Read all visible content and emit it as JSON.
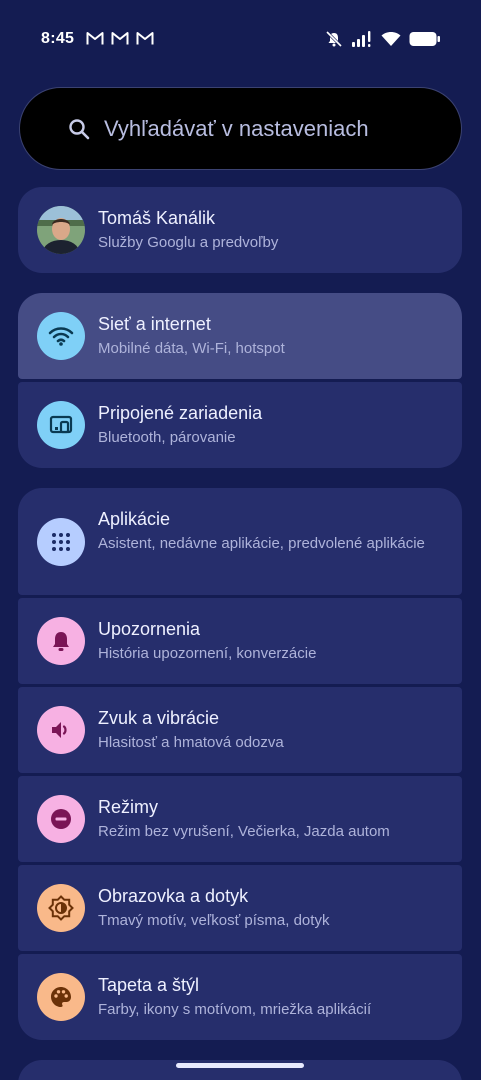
{
  "status_bar": {
    "time": "8:45",
    "notification_icons": [
      "gmail-icon",
      "gmail-icon",
      "gmail-icon"
    ],
    "right_icons": [
      "mute-icon",
      "signal-icon",
      "wifi-icon",
      "battery-icon"
    ]
  },
  "search": {
    "placeholder": "Vyhľadávať v nastaveniach"
  },
  "account": {
    "name": "Tomáš Kanálik",
    "subtitle": "Služby Googlu a predvoľby"
  },
  "items": [
    {
      "title": "Sieť a internet",
      "subtitle": "Mobilné dáta, Wi-Fi, hotspot",
      "icon": "wifi-icon",
      "color": "#7fd0f7"
    },
    {
      "title": "Pripojené zariadenia",
      "subtitle": "Bluetooth, párovanie",
      "icon": "devices-icon",
      "color": "#7fd0f7"
    },
    {
      "title": "Aplikácie",
      "subtitle": "Asistent, nedávne aplikácie, predvolené aplikácie",
      "icon": "apps-grid-icon",
      "color": "#b6cdff"
    },
    {
      "title": "Upozornenia",
      "subtitle": "História upozornení, konverzácie",
      "icon": "bell-icon",
      "color": "#f7b1e3"
    },
    {
      "title": "Zvuk a vibrácie",
      "subtitle": "Hlasitosť a hmatová odozva",
      "icon": "speaker-icon",
      "color": "#f7b1e3"
    },
    {
      "title": "Režimy",
      "subtitle": "Režim bez vyrušení, Večierka, Jazda autom",
      "icon": "do-not-disturb-icon",
      "color": "#f7b1e3"
    },
    {
      "title": "Obrazovka a dotyk",
      "subtitle": "Tmavý motív, veľkosť písma, dotyk",
      "icon": "brightness-icon",
      "color": "#f9b98a"
    },
    {
      "title": "Tapeta a štýl",
      "subtitle": "Farby, ikony s motívom, mriežka aplikácií",
      "icon": "palette-icon",
      "color": "#f9b98a"
    }
  ],
  "colors": {
    "background": "#141c52",
    "card": "#262e6c",
    "card_highlight": "#454c85",
    "title_text": "#eef0ff",
    "subtitle_text": "#aeb3da"
  }
}
